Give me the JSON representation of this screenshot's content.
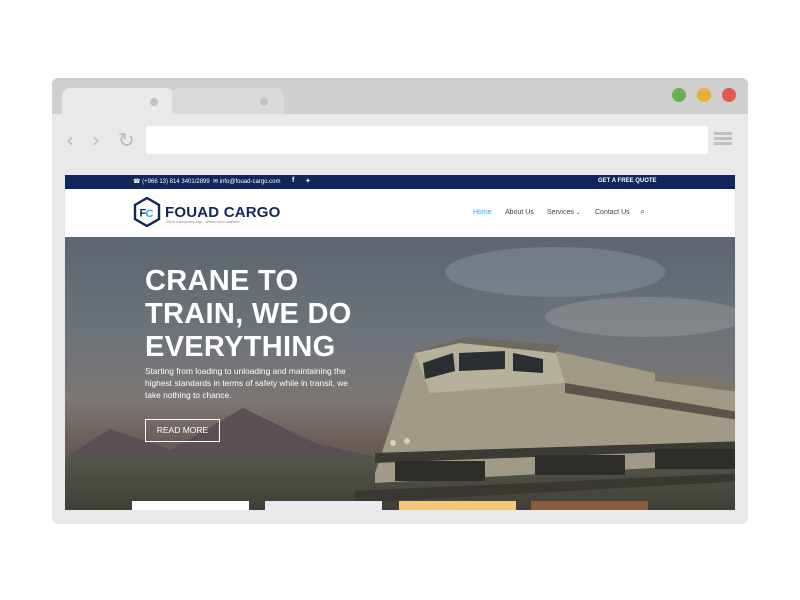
{
  "topbar": {
    "phone": "(+966 13) 814 3401/2899",
    "email": "info@fouad-cargo.com",
    "cta": "GET A FREE QUOTE"
  },
  "header": {
    "logo_text": "FOUAD CARGO",
    "logo_tagline": "This is a temporary logo - details when available",
    "nav": {
      "home": "Home",
      "about": "About Us",
      "services": "Services",
      "contact": "Contact Us"
    }
  },
  "hero": {
    "title": "CRANE TO TRAIN, WE DO EVERYTHING",
    "text": "Starting from loading to unloading and maintaining the highest standards in terms of safety while in transit, we take nothing to chance.",
    "button": "READ MORE"
  },
  "colors": {
    "brand_navy": "#12255c",
    "link_active": "#2ea3f2"
  },
  "icons": [
    "back-icon",
    "forward-icon",
    "reload-icon",
    "menu-icon",
    "phone-icon",
    "mail-icon",
    "facebook-icon",
    "twitter-icon",
    "search-icon",
    "chevron-down-icon"
  ]
}
